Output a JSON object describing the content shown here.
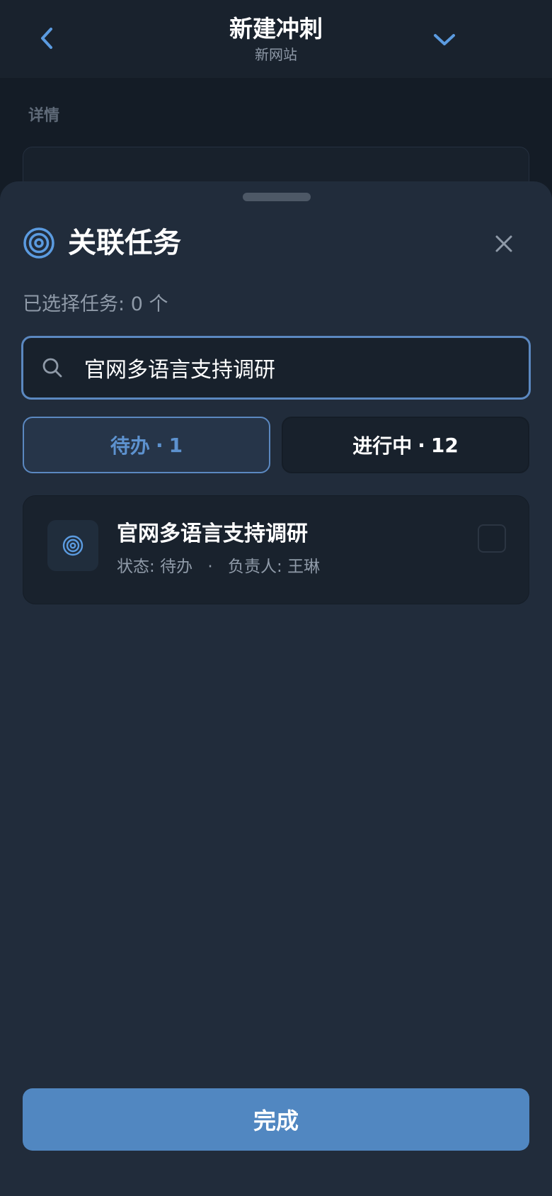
{
  "header": {
    "title": "新建冲刺",
    "subtitle": "新网站"
  },
  "background": {
    "section_label": "详情"
  },
  "sheet": {
    "title": "关联任务",
    "selected_label": "已选择任务:",
    "selected_count": "0",
    "selected_unit": "个",
    "search": {
      "value": "官网多语言支持调研",
      "placeholder": ""
    },
    "tabs": [
      {
        "label": "待办",
        "count": "1",
        "active": true
      },
      {
        "label": "进行中",
        "count": "12",
        "active": false
      }
    ],
    "tab_separator": "·",
    "tasks": [
      {
        "title": "官网多语言支持调研",
        "status_label": "状态:",
        "status": "待办",
        "separator": "·",
        "owner_label": "负责人:",
        "owner": "王琳",
        "checked": false
      }
    ],
    "done_label": "完成"
  },
  "colors": {
    "accent": "#5b88c0",
    "button": "#5187c1",
    "sheet_bg": "#212c3b",
    "page_bg": "#141c26"
  },
  "icons": {
    "back": "chevron-left-icon",
    "collapse": "chevron-down-icon",
    "sheet": "target-icon",
    "close": "close-icon",
    "search": "search-icon",
    "task": "target-icon"
  }
}
